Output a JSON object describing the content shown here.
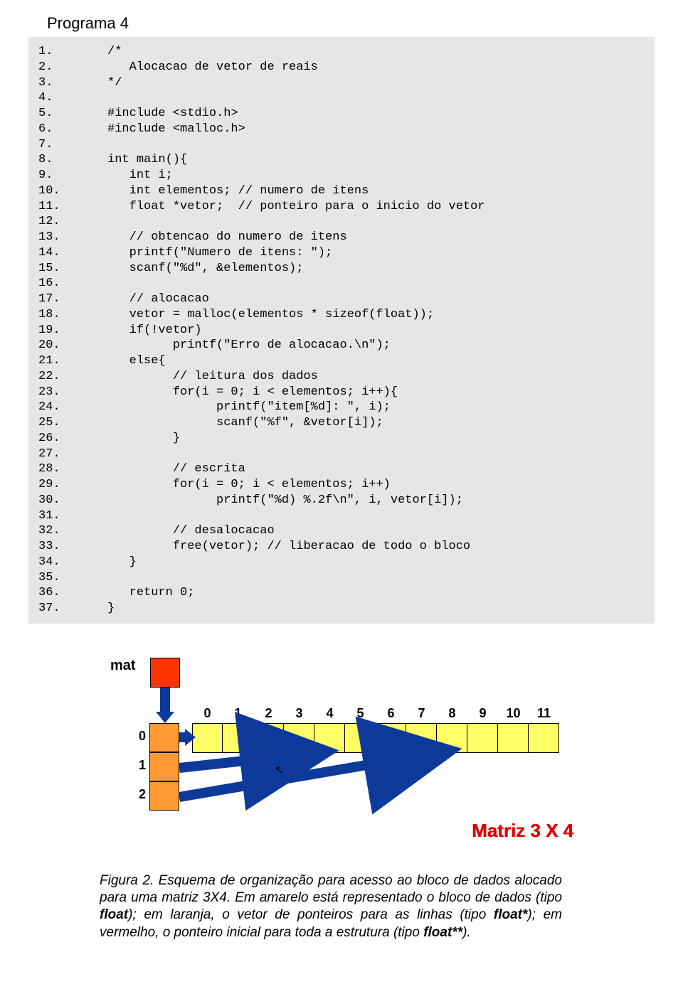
{
  "title": "Programa 4",
  "code": [
    {
      "n": "1.",
      "t": "     /*"
    },
    {
      "n": "2.",
      "t": "        Alocacao de vetor de reais"
    },
    {
      "n": "3.",
      "t": "     */"
    },
    {
      "n": "4.",
      "t": ""
    },
    {
      "n": "5.",
      "t": "     #include <stdio.h>"
    },
    {
      "n": "6.",
      "t": "     #include <malloc.h>"
    },
    {
      "n": "7.",
      "t": ""
    },
    {
      "n": "8.",
      "t": "     int main(){"
    },
    {
      "n": "9.",
      "t": "        int i;"
    },
    {
      "n": "10.",
      "t": "        int elementos; // numero de itens"
    },
    {
      "n": "11.",
      "t": "        float *vetor;  // ponteiro para o inicio do vetor"
    },
    {
      "n": "12.",
      "t": ""
    },
    {
      "n": "13.",
      "t": "        // obtencao do numero de itens"
    },
    {
      "n": "14.",
      "t": "        printf(\"Numero de itens: \");"
    },
    {
      "n": "15.",
      "t": "        scanf(\"%d\", &elementos);"
    },
    {
      "n": "16.",
      "t": ""
    },
    {
      "n": "17.",
      "t": "        // alocacao"
    },
    {
      "n": "18.",
      "t": "        vetor = malloc(elementos * sizeof(float));"
    },
    {
      "n": "19.",
      "t": "        if(!vetor)"
    },
    {
      "n": "20.",
      "t": "              printf(\"Erro de alocacao.\\n\");"
    },
    {
      "n": "21.",
      "t": "        else{"
    },
    {
      "n": "22.",
      "t": "              // leitura dos dados"
    },
    {
      "n": "23.",
      "t": "              for(i = 0; i < elementos; i++){"
    },
    {
      "n": "24.",
      "t": "                    printf(\"item[%d]: \", i);"
    },
    {
      "n": "25.",
      "t": "                    scanf(\"%f\", &vetor[i]);"
    },
    {
      "n": "26.",
      "t": "              }"
    },
    {
      "n": "27.",
      "t": ""
    },
    {
      "n": "28.",
      "t": "              // escrita"
    },
    {
      "n": "29.",
      "t": "              for(i = 0; i < elementos; i++)"
    },
    {
      "n": "30.",
      "t": "                    printf(\"%d) %.2f\\n\", i, vetor[i]);"
    },
    {
      "n": "31.",
      "t": ""
    },
    {
      "n": "32.",
      "t": "              // desalocacao"
    },
    {
      "n": "33.",
      "t": "              free(vetor); // liberacao de todo o bloco"
    },
    {
      "n": "34.",
      "t": "        }"
    },
    {
      "n": "35.",
      "t": ""
    },
    {
      "n": "36.",
      "t": "        return 0;"
    },
    {
      "n": "37.",
      "t": "     }"
    }
  ],
  "diagram": {
    "mat_label": "mat",
    "row_labels": [
      "0",
      "1",
      "2"
    ],
    "col_labels": [
      "0",
      "1",
      "2",
      "3",
      "4",
      "5",
      "6",
      "7",
      "8",
      "9",
      "10",
      "11"
    ],
    "matrix_title": "Matriz 3 X 4"
  },
  "caption": {
    "lead": "Figura 2. Esquema de organização para acesso ao bloco de dados alocado para uma matriz 3X4. Em amarelo está representado o bloco de dados (tipo ",
    "t1": "float",
    "mid1": "); em laranja, o vetor de ponteiros para as linhas (tipo ",
    "t2": "float*",
    "mid2": "); em vermelho, o ponteiro inicial para toda a estrutura (tipo ",
    "t3": "float**",
    "tail": ")."
  }
}
